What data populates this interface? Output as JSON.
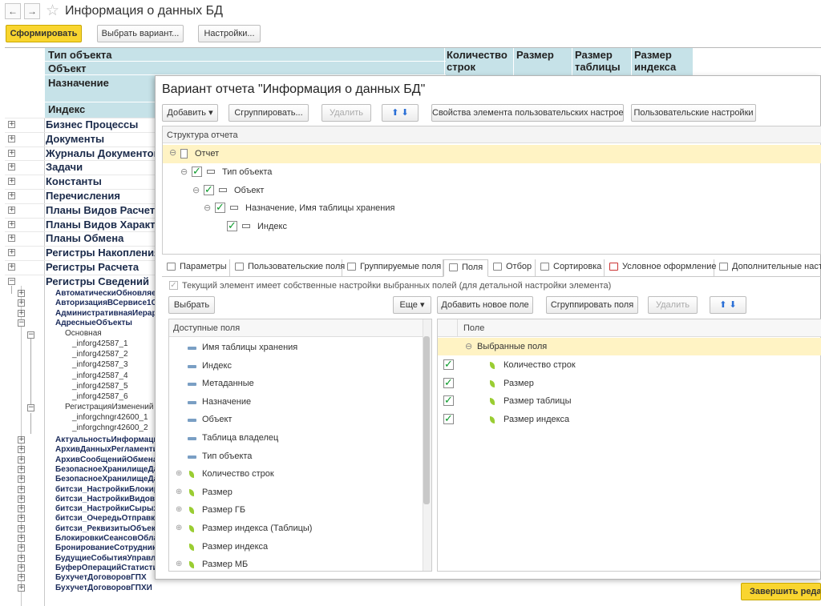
{
  "header": {
    "title": "Информация о данных БД",
    "back": "←",
    "forward": "→",
    "star": "☆"
  },
  "toolbar": {
    "generate": "Сформировать",
    "variant": "Выбрать вариант...",
    "settings": "Настройки..."
  },
  "report": {
    "columns": {
      "object_type": "Тип объекта",
      "object": "Объект",
      "purpose": "Назначение",
      "index": "Индекс",
      "rows": "Количество строк",
      "size": "Размер",
      "table_size": "Размер таблицы",
      "index_size": "Размер индекса"
    },
    "groups": [
      "Бизнес Процессы",
      "Документы",
      "Журналы Документов",
      "Задачи",
      "Константы",
      "Перечисления",
      "Планы Видов Расчета",
      "Планы Видов Характеристик",
      "Планы Обмена",
      "Регистры Накопления",
      "Регистры Расчета",
      "Регистры Сведений"
    ],
    "sub_top": [
      "АвтоматическиОбновляемые",
      "АвторизацияВСервисе1С",
      "АдминистративнаяИерархия",
      "АдресныеОбъекты"
    ],
    "main_label": "Основная",
    "main_items": [
      "_inforg42587_1",
      "_inforg42587_2",
      "_inforg42587_3",
      "_inforg42587_4",
      "_inforg42587_5",
      "_inforg42587_6"
    ],
    "reg_label": "РегистрацияИзменений",
    "reg_items": [
      "_inforgchngr42600_1",
      "_inforgchngr42600_2"
    ],
    "sub_bottom": [
      "АктуальностьИнформации",
      "АрхивДанныхРегламентированных",
      "АрхивСообщенийОбмена",
      "БезопасноеХранилищеДанных",
      "БезопасноеХранилищеДанныхОбластей",
      "битсзи_НастройкиБлокировки",
      "битсзи_НастройкиВидов",
      "битсзи_НастройкиСырых",
      "битсзи_ОчередьОтправки",
      "битсзи_РеквизитыОбъектов",
      "БлокировкиСеансовОбластей",
      "БронированиеСотрудников",
      "БудущиеСобытияУправления",
      "БуферОперацийСтатистики",
      "БухучетДоговоровГПХ",
      "БухучетДоговоровГПХИ"
    ]
  },
  "dialog": {
    "title": "Вариант отчета \"Информация о данных БД\"",
    "buttons": {
      "add": "Добавить",
      "group": "Сгруппировать...",
      "delete": "Удалить",
      "up": "⬆",
      "down": "⬇",
      "element_props": "Свойства элемента пользовательских настроек",
      "user_settings": "Пользовательские настройки"
    },
    "structure": {
      "header": "Структура отчета",
      "items": [
        "Отчет",
        "Тип объекта",
        "Объект",
        "Назначение, Имя таблицы хранения",
        "Индекс"
      ]
    },
    "tabs": [
      "Параметры",
      "Пользовательские поля",
      "Группируемые поля",
      "Поля",
      "Отбор",
      "Сортировка",
      "Условное оформление",
      "Дополнительные настро"
    ],
    "fields_panel": {
      "own_settings": "Текущий элемент имеет собственные настройки выбранных полей (для детальной настройки элемента)",
      "choose": "Выбрать",
      "more": "Еще",
      "add_new": "Добавить новое поле",
      "group_fields": "Сгруппировать поля",
      "delete": "Удалить",
      "available_header": "Доступные поля",
      "available": [
        "Имя таблицы хранения",
        "Индекс",
        "Метаданные",
        "Назначение",
        "Объект",
        "Таблица владелец",
        "Тип объекта",
        "Количество строк",
        "Размер",
        "Размер ГБ",
        "Размер индекса (Таблицы)",
        "Размер индекса",
        "Размер МБ"
      ],
      "selected_header": "Поле",
      "selected_group": "Выбранные поля",
      "selected": [
        "Количество строк",
        "Размер",
        "Размер таблицы",
        "Размер индекса"
      ]
    },
    "finish": "Завершить редак"
  },
  "colors": {
    "accent": "#f9d52f",
    "header_bg": "#c6e2e8",
    "selected_row": "#fff3c4",
    "link": "#1a2a5a"
  }
}
